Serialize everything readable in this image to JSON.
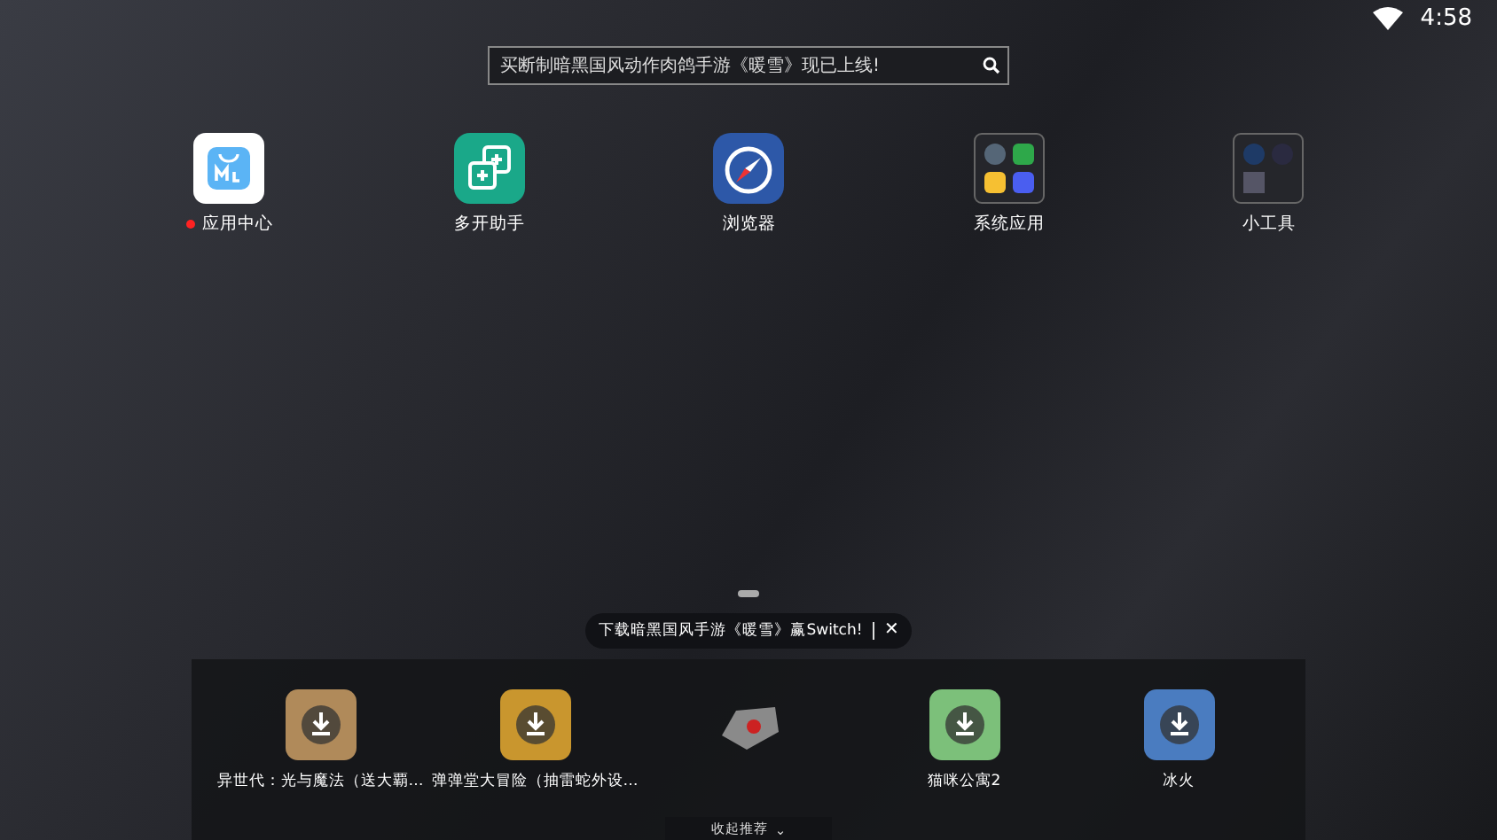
{
  "status_bar": {
    "time": "4:58"
  },
  "search": {
    "placeholder": "买断制暗黑国风动作肉鸽手游《暖雪》现已上线!"
  },
  "apps": [
    {
      "label": "应用中心",
      "kind": "store",
      "new_badge": true
    },
    {
      "label": "多开助手",
      "kind": "multi",
      "new_badge": false
    },
    {
      "label": "浏览器",
      "kind": "browser",
      "new_badge": false
    },
    {
      "label": "系统应用",
      "kind": "folder",
      "new_badge": false
    },
    {
      "label": "小工具",
      "kind": "tools",
      "new_badge": false
    }
  ],
  "tooltip": {
    "text": "下载暗黑国风手游《暖雪》赢Switch!",
    "close": "✕"
  },
  "recommended": [
    {
      "label": "异世代：光与魔法（送大覇…",
      "kind": "download",
      "color": "#b08a5a"
    },
    {
      "label": "弹弹堂大冒险（抽雷蛇外设…",
      "kind": "download",
      "color": "#c9962e"
    },
    {
      "kind": "artwork",
      "color": "#8a8a8a"
    },
    {
      "label": "猫咪公寓2",
      "kind": "download",
      "color": "#7cc07a"
    },
    {
      "label": "冰火",
      "kind": "download",
      "color": "#4a7cc0"
    }
  ],
  "collapse": {
    "label": "收起推荐",
    "caret": "⌄"
  }
}
